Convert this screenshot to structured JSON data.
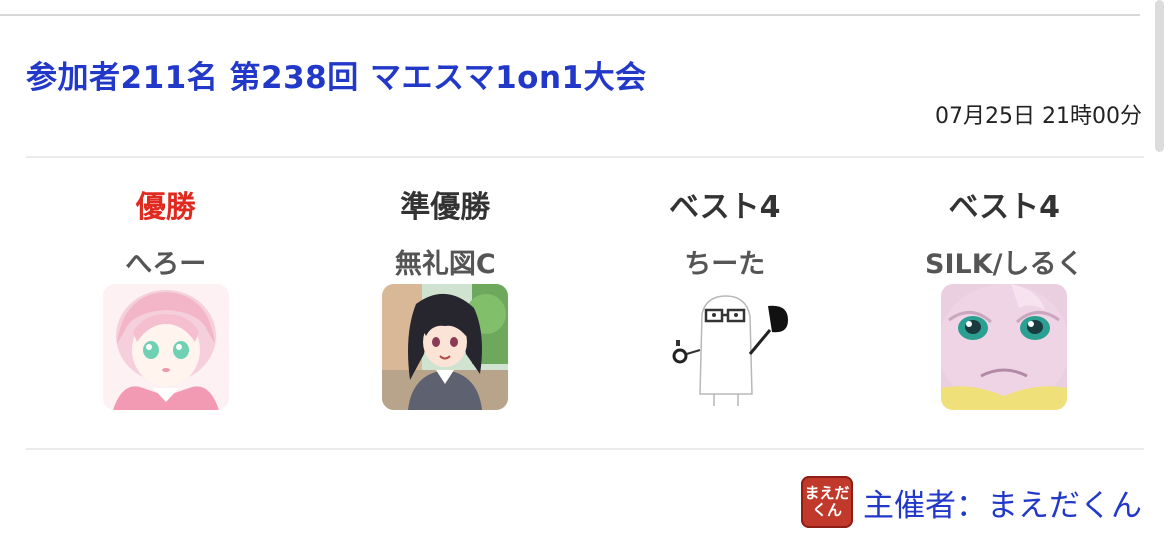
{
  "tournament": {
    "title": "参加者211名 第238回 マエスマ1on1大会",
    "datetime": "07月25日 21時00分"
  },
  "results": [
    {
      "rank": "優勝",
      "name": "へろー",
      "avatar": "anime-girl-pink-hair-avatar"
    },
    {
      "rank": "準優勝",
      "name": "無礼図C",
      "avatar": "anime-girl-dark-hair-avatar"
    },
    {
      "rank": "ベスト4",
      "name": "ちーた",
      "avatar": "stick-figure-glasses-avatar"
    },
    {
      "rank": "ベスト4",
      "name": "SILK/しるく",
      "avatar": "pink-creature-avatar"
    }
  ],
  "organizer": {
    "label": "主催者：まえだくん",
    "icon_line1": "まえだ",
    "icon_line2": "くん",
    "icon": "maedakun-icon"
  },
  "colors": {
    "title": "#2238c8",
    "winner_rank": "#e02a20",
    "rank": "#333333",
    "name": "#555555",
    "organizer_icon": "#c0392b"
  }
}
